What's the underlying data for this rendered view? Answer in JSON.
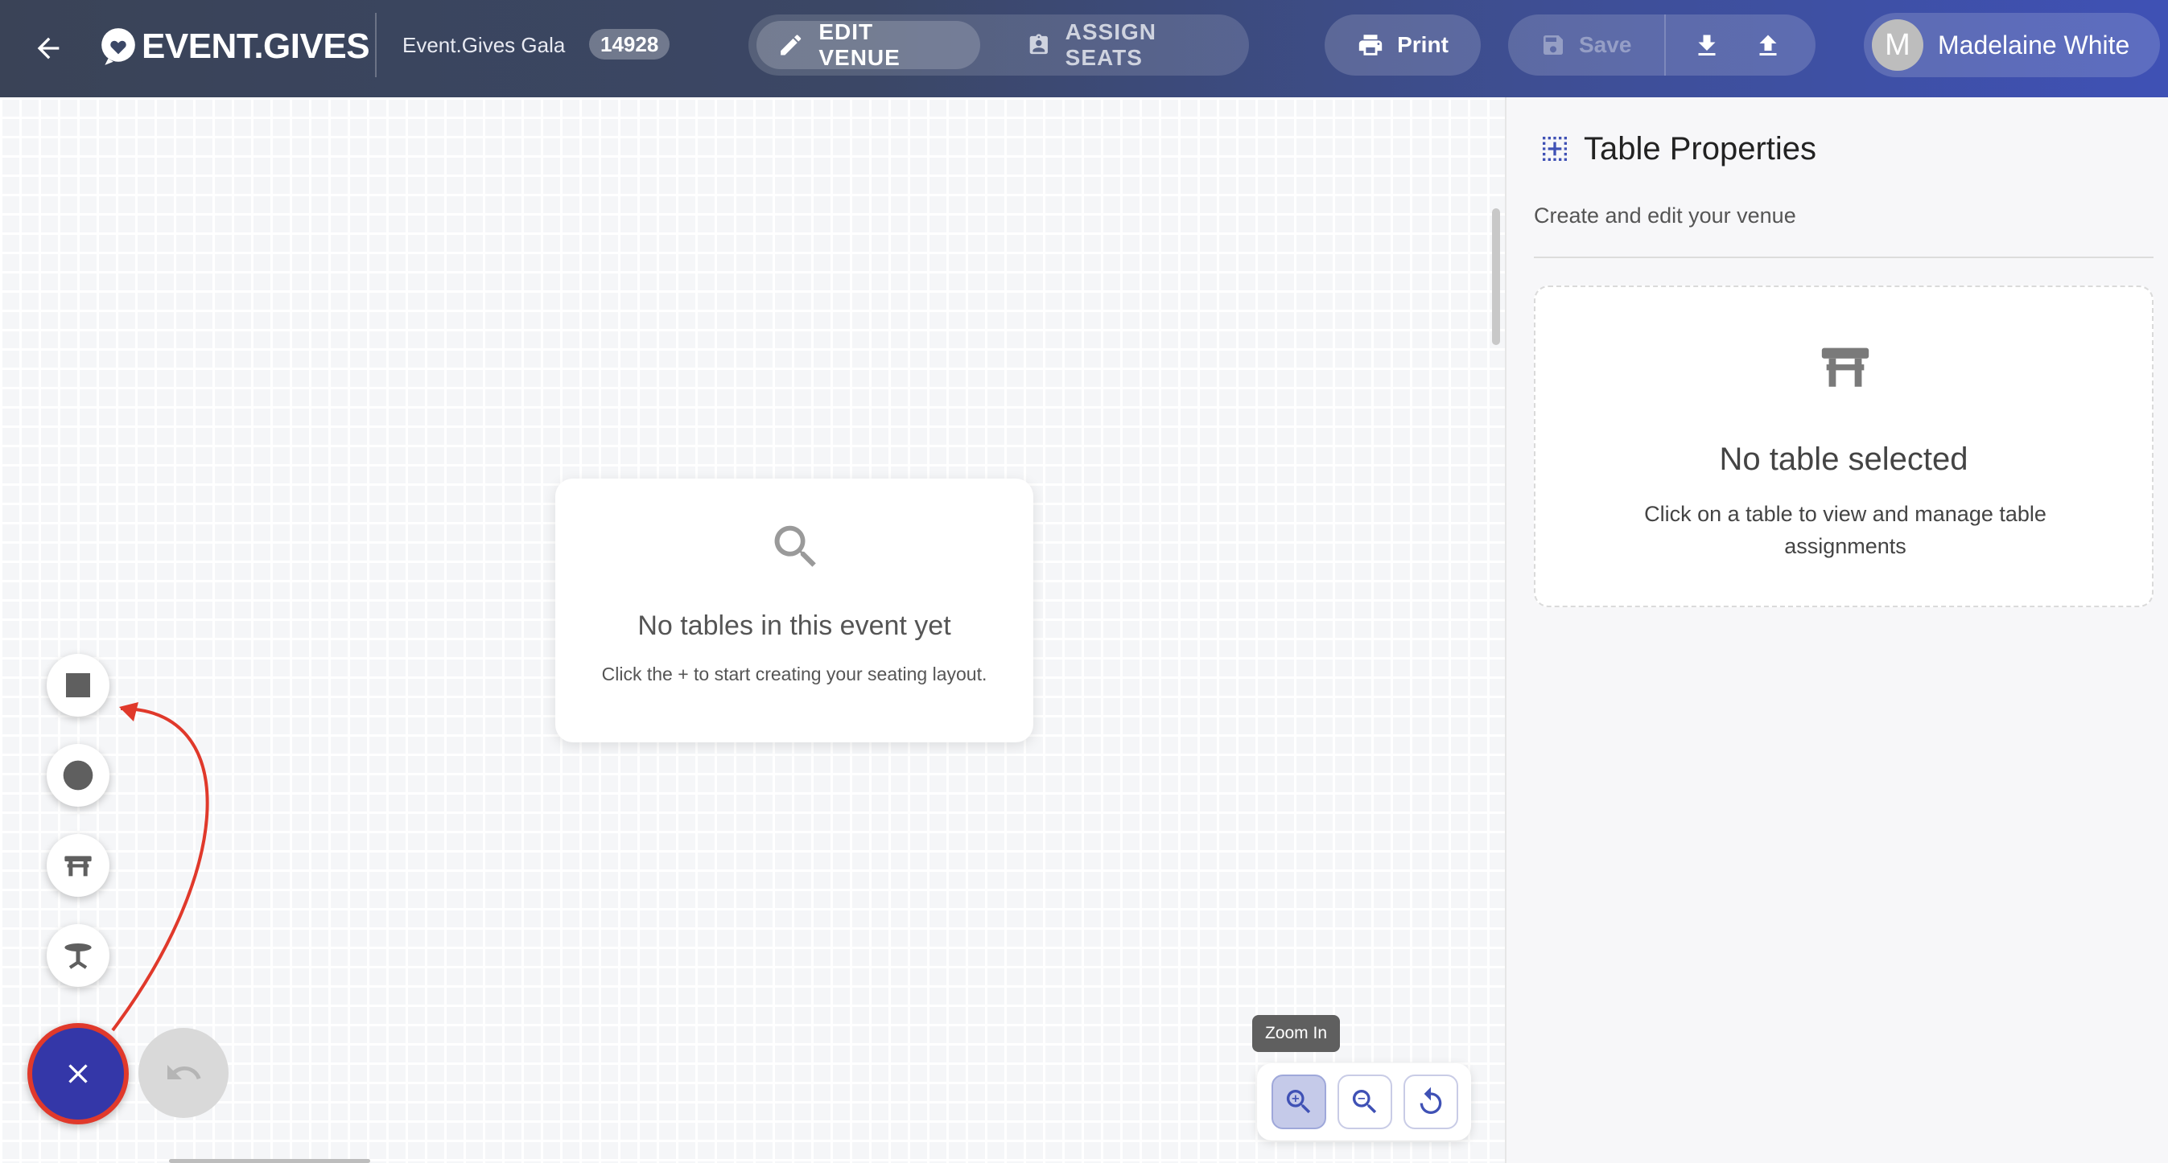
{
  "header": {
    "logo_text": "EVENT.GIVES",
    "event_name": "Event.Gives Gala",
    "event_id": "14928",
    "mode_edit_label": "EDIT VENUE",
    "mode_assign_label": "ASSIGN SEATS",
    "print_label": "Print",
    "save_label": "Save",
    "user_initial": "M",
    "user_name": "Madelaine White",
    "icons": [
      "back-arrow-icon",
      "logo-heart-icon",
      "pencil-icon",
      "badge-icon",
      "printer-icon",
      "save-disk-icon",
      "download-icon",
      "upload-icon"
    ]
  },
  "canvas": {
    "empty_title": "No tables in this event yet",
    "empty_subtitle": "Click the + to start creating your seating layout.",
    "tools": [
      {
        "name": "square-table",
        "icon": "square-icon"
      },
      {
        "name": "round-table",
        "icon": "circle-icon"
      },
      {
        "name": "banquet-table",
        "icon": "rect-table-icon"
      },
      {
        "name": "cocktail-table",
        "icon": "cocktail-table-icon"
      }
    ],
    "zoom_tooltip": "Zoom In",
    "colors": {
      "fab": "#3437a8",
      "fab_ring": "#e0392b",
      "annotation_arrow": "#e0392b"
    }
  },
  "side_panel": {
    "title": "Table Properties",
    "subtitle": "Create and edit your venue",
    "empty_title": "No table selected",
    "empty_desc": "Click on a table to view and manage table assignments"
  }
}
